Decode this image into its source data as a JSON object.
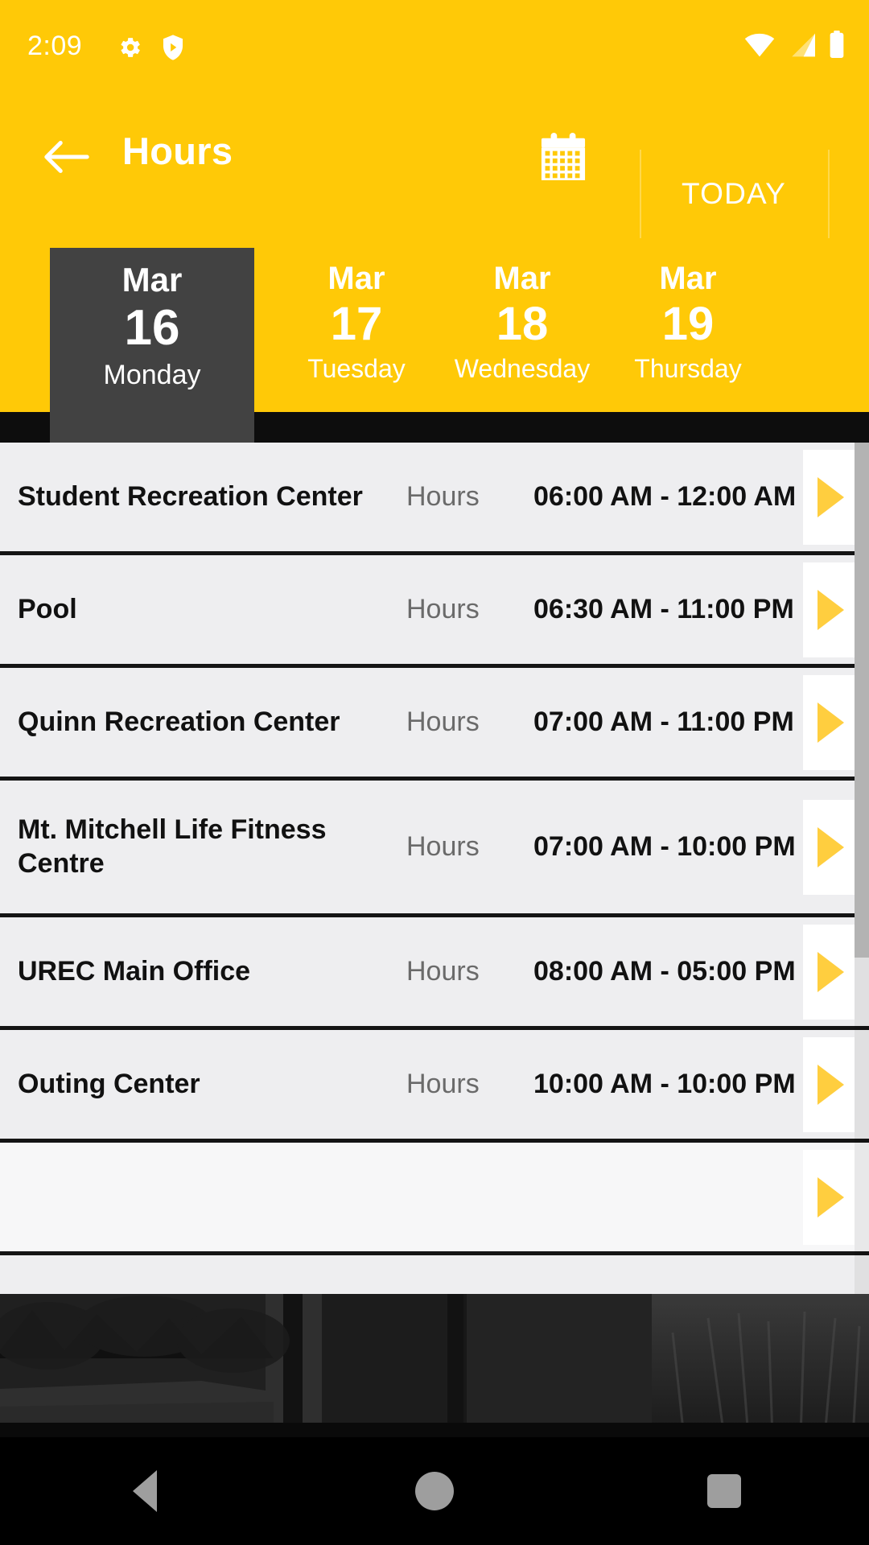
{
  "status_bar": {
    "time": "2:09",
    "icons": [
      "gear-icon",
      "shield-play-icon",
      "wifi-icon",
      "cellular-signal-icon",
      "battery-icon"
    ]
  },
  "app_bar": {
    "back_label": "back-arrow",
    "title": "Hours",
    "calendar_icon": "calendar-icon",
    "today_label": "TODAY"
  },
  "date_tabs": [
    {
      "month": "Mar",
      "day": "16",
      "weekday": "Monday",
      "selected": true
    },
    {
      "month": "Mar",
      "day": "17",
      "weekday": "Tuesday",
      "selected": false
    },
    {
      "month": "Mar",
      "day": "18",
      "weekday": "Wednesday",
      "selected": false
    },
    {
      "month": "Mar",
      "day": "19",
      "weekday": "Thursday",
      "selected": false
    }
  ],
  "list": {
    "hours_label": "Hours",
    "rows": [
      {
        "name": "Student Recreation Center",
        "hours_label": "Hours",
        "time": "06:00 AM - 12:00 AM"
      },
      {
        "name": "Pool",
        "hours_label": "Hours",
        "time": "06:30 AM - 11:00 PM"
      },
      {
        "name": "Quinn Recreation Center",
        "hours_label": "Hours",
        "time": "07:00 AM - 11:00 PM"
      },
      {
        "name": "Mt. Mitchell Life Fitness Centre",
        "hours_label": "Hours",
        "time": "07:00 AM - 10:00 PM"
      },
      {
        "name": "UREC Main Office",
        "hours_label": "Hours",
        "time": "08:00 AM - 05:00 PM"
      },
      {
        "name": "Outing Center",
        "hours_label": "Hours",
        "time": "10:00 AM - 10:00 PM"
      }
    ]
  },
  "nav_bar": {
    "back": "nav-back-icon",
    "home": "nav-home-icon",
    "recents": "nav-recents-icon"
  },
  "colors": {
    "brand_yellow": "#FFC907",
    "selected_tab": "#424242",
    "row_bg": "#eeeef0",
    "chevron_yellow": "#FFCE3F",
    "divider": "#141414"
  }
}
